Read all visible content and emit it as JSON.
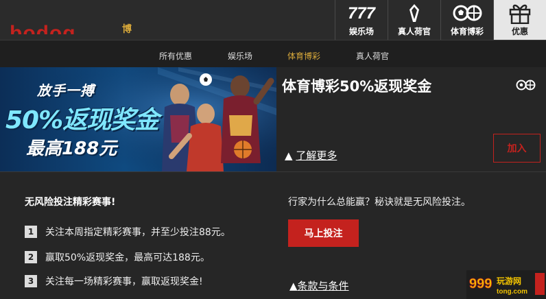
{
  "header": {
    "logo_text": "bodog",
    "logo_tag": "博",
    "nav": [
      {
        "label": "娱乐场",
        "icon": "777-slots-icon"
      },
      {
        "label": "真人荷官",
        "icon": "dealer-icon"
      },
      {
        "label": "体育博彩",
        "icon": "sports-balls-icon"
      },
      {
        "label": "优惠",
        "icon": "gift-icon"
      }
    ]
  },
  "subtabs": [
    "所有优惠",
    "娱乐场",
    "体育博彩",
    "真人荷官"
  ],
  "banner": {
    "line1": "放手一搏",
    "line2": "50%返现奖金",
    "line3": "最高188元"
  },
  "promo": {
    "title": "体育博彩50%返现奖金",
    "learn_more": "了解更多",
    "join": "加入"
  },
  "steps": {
    "title": "无风险投注精彩赛事!",
    "items": [
      {
        "num": "1",
        "text": "关注本周指定精彩赛事，并至少投注88元。"
      },
      {
        "num": "2",
        "text": "赢取50%返现奖金，最高可达188元。"
      },
      {
        "num": "3",
        "text": "关注每一场精彩赛事，赢取返现奖金!"
      }
    ]
  },
  "cta": {
    "secret": "行家为什么总能赢？秘诀就是无风险投注。",
    "bet": "马上投注",
    "terms": "条款与条件"
  },
  "watermark": {
    "line1": "999",
    "line2": "玩游网",
    "line3": "tong.com"
  },
  "colors": {
    "accent": "#c4221e",
    "gold": "#d9a93a",
    "bg": "#262626"
  }
}
